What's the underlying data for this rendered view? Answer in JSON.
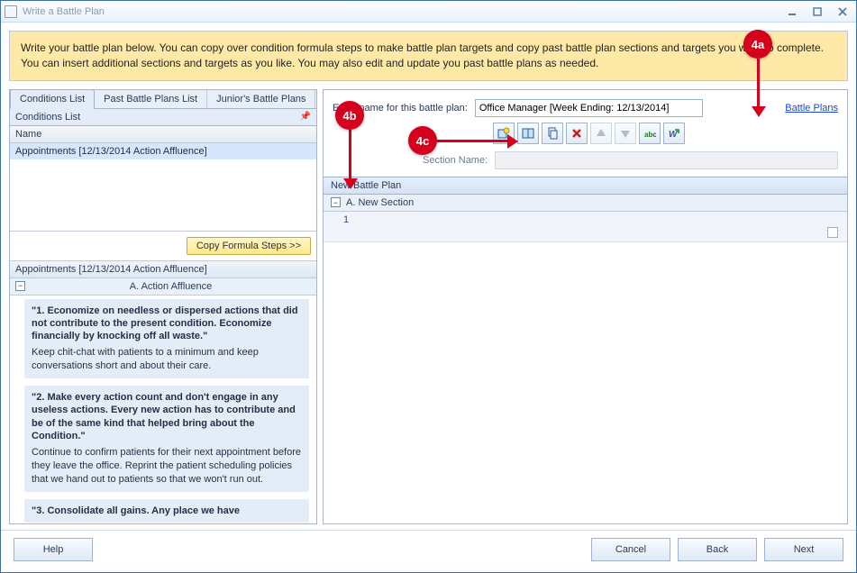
{
  "window": {
    "title": "Write a Battle Plan"
  },
  "notice": "Write your battle plan below. You can copy over condition formula steps to make battle plan targets and copy past battle plan sections and targets you want to complete. You can insert additional sections and targets as you like. You may also edit and update you past battle plans as needed.",
  "left": {
    "tabs": [
      {
        "label": "Conditions List",
        "active": true
      },
      {
        "label": "Past Battle Plans List",
        "active": false
      },
      {
        "label": "Junior's Battle Plans",
        "active": false
      }
    ],
    "panel_title": "Conditions List",
    "list_header": "Name",
    "list_rows": [
      "Appointments [12/13/2014 Action Affluence]"
    ],
    "copy_button": "Copy Formula Steps >>",
    "sub_header": "Appointments [12/13/2014 Action Affluence]",
    "tree_node": "A. Action Affluence",
    "steps": [
      {
        "title": "\"1. Economize on needless or dispersed actions that did not contribute to the present condition. Economize financially by knocking off all waste.\"",
        "desc": "Keep chit-chat with patients to a minimum and keep conversations short and about their care."
      },
      {
        "title": "\"2. Make every action count and don't engage in any useless actions. Every new action has to contribute and be of the same kind that helped bring about the Condition.\"",
        "desc": "Continue to confirm patients for their next appointment before they leave the office. Reprint the patient scheduling policies that we hand out to patients so that we won't run out."
      },
      {
        "title": "\"3. Consolidate all gains. Any place we have",
        "desc": ""
      }
    ]
  },
  "right": {
    "name_label": "Enter name for this battle plan:",
    "name_value": "Office Manager [Week Ending: 12/13/2014]",
    "link_label": "Battle Plans",
    "toolbar": [
      "new-section-icon",
      "new-target-icon",
      "copy-icon",
      "delete-icon",
      "move-up-icon",
      "move-down-icon",
      "rename-icon",
      "export-icon"
    ],
    "section_name_label": "Section Name:",
    "bp_header": "New Battle Plan",
    "bp_section": "A. New Section",
    "bp_row": "1"
  },
  "footer": {
    "help": "Help",
    "cancel": "Cancel",
    "back": "Back",
    "next": "Next"
  },
  "callouts": {
    "a": "4a",
    "b": "4b",
    "c": "4c"
  }
}
